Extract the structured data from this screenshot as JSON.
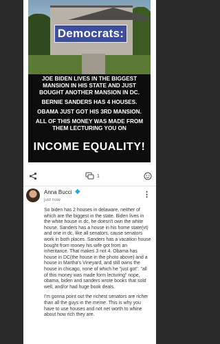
{
  "meme": {
    "headline": "Democrats:",
    "lines": [
      "JOE BIDEN LIVES IN THE BIGGEST MANSION IN HIS STATE AND JUST BOUGHT ANOTHER MANSION IN DC.",
      "BERNIE SANDERS HAS 4 HOUSES.",
      "OBAMA JUST GOT HIS 3RD MANSION.",
      "ALL OF THIS MONEY WAS MADE FROM THEM LECTURING YOU ON"
    ],
    "punchline": "INCOME EQUALITY!"
  },
  "actions": {
    "share_icon": "share-icon",
    "comments_icon": "comment-icon",
    "comments_count": "1",
    "reaction_icon": "smiley-icon"
  },
  "comment": {
    "author": "Anna Bucci",
    "badge_icon": "diamond-icon",
    "time": "just now",
    "paragraphs": [
      "So biden has 2 houses in delaware, neither of which are the biggest in the state. Biden lives in the white house in dc, he doesn't own the white house. Sanders has a house in his home state(vt) and one in dc, like all senators, cause senators work in both places. Sanders has a vacation house bought from money his wife got from an inheritance. That makes 3 not 4. Obama has house in DC(the house in the photo above) and a house in Martha's Vineyard, and still owns the house in chicago, none of which he \"just got\". \"all of this money was made form lecturing\" nope, obama, biden and sanders wrote books that sold well, and/or had huge book deals.",
      "I'm gonna point out the richest senators are richer than all the guys in the meme. This is why you have to use houses and not net worth to whine about how rich they are."
    ]
  }
}
